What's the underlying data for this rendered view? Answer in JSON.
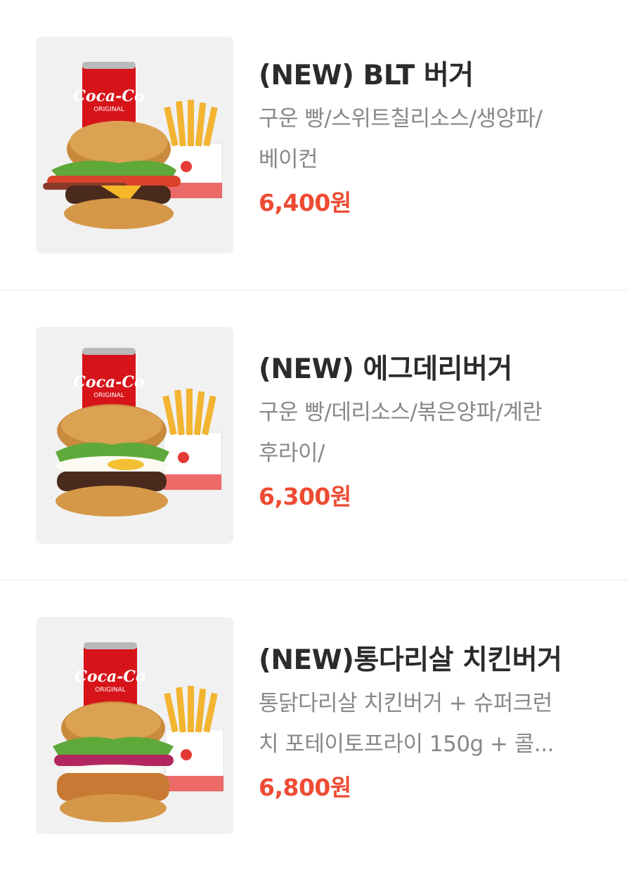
{
  "colors": {
    "title": "#2b2b2b",
    "description": "#888888",
    "price": "#ee4b33",
    "thumbnail_bg": "#f1f1f1",
    "divider": "#ebebeb"
  },
  "items": [
    {
      "name": "(NEW) BLT 버거",
      "description_lines": [
        "구운 빵/스위트칠리소스/생양파/",
        "베이컨"
      ],
      "price": "6,400원",
      "image_label": "ORIGINAL",
      "image_alt": "BLT burger set with cola and fries"
    },
    {
      "name": "(NEW) 에그데리버거",
      "description_lines": [
        "구운 빵/데리소스/볶은양파/계란",
        "후라이/"
      ],
      "price": "6,300원",
      "image_label": "ORIGINAL",
      "image_alt": "Egg teriyaki burger set with cola and fries"
    },
    {
      "name": "(NEW)통다리살 치킨버거",
      "description_lines": [
        "통닭다리살 치킨버거 + 슈퍼크런",
        "치 포테이토프라이 150g + 콜..."
      ],
      "price": "6,800원",
      "image_label": "ORIGINAL",
      "image_alt": "Chicken thigh burger set with cola and fries"
    }
  ]
}
